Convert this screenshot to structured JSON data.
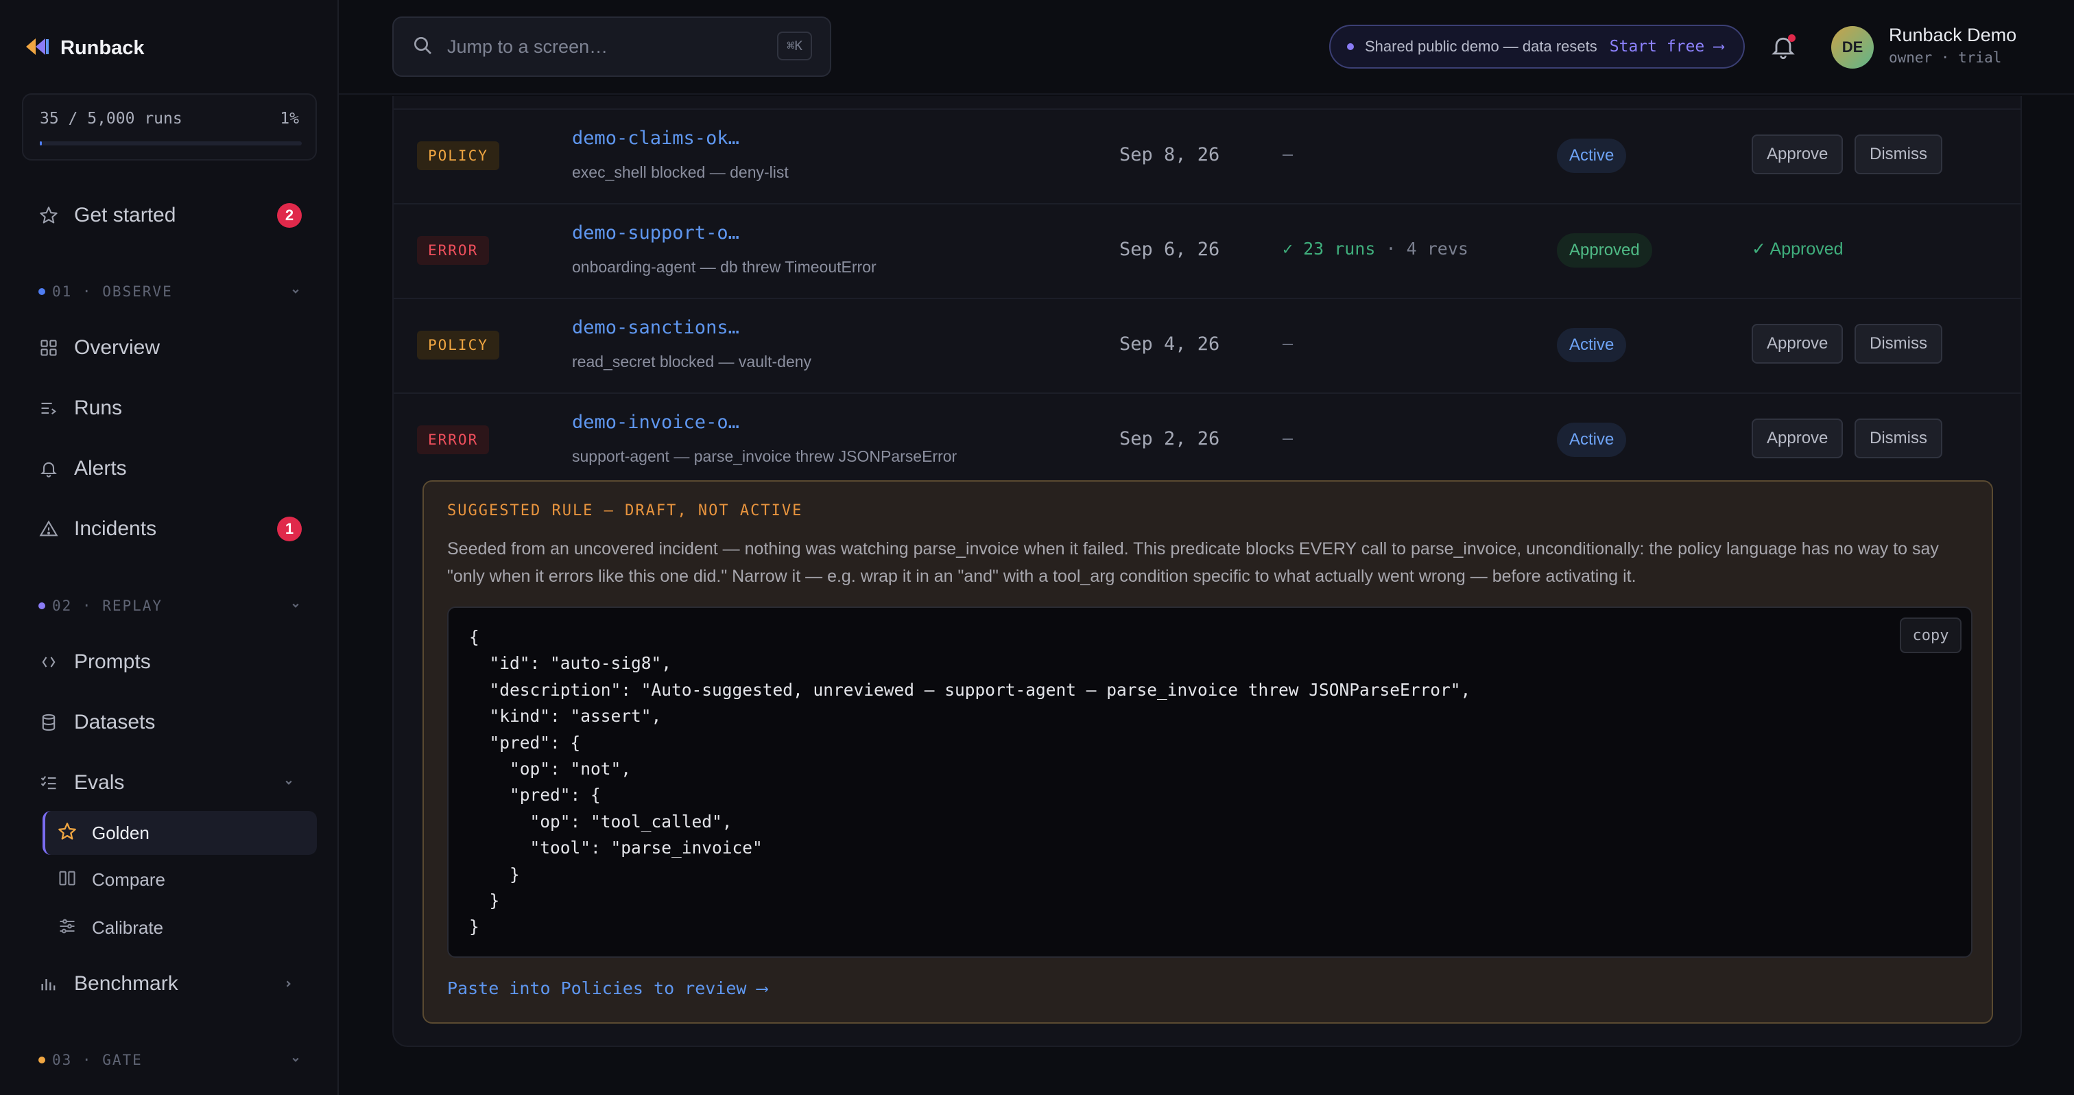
{
  "app": {
    "name": "Runback"
  },
  "usage": {
    "text": "35 / 5,000 runs",
    "percent_label": "1%",
    "fill_fraction": 0.007
  },
  "sidebar": {
    "get_started": {
      "label": "Get started",
      "badge": "2"
    },
    "sections": [
      {
        "label": "01 · OBSERVE",
        "dot_color": "#4f7df2"
      },
      {
        "label": "02 · REPLAY",
        "dot_color": "#8a7cf5"
      },
      {
        "label": "03 · GATE",
        "dot_color": "#f0a642"
      }
    ],
    "observe_items": [
      {
        "label": "Overview",
        "icon": "grid-icon"
      },
      {
        "label": "Runs",
        "icon": "list-arrow-icon"
      },
      {
        "label": "Alerts",
        "icon": "bell-icon"
      },
      {
        "label": "Incidents",
        "icon": "warning-icon",
        "badge": "1"
      }
    ],
    "replay_items": [
      {
        "label": "Prompts",
        "icon": "code-brackets-icon"
      },
      {
        "label": "Datasets",
        "icon": "database-icon"
      },
      {
        "label": "Evals",
        "icon": "checklist-icon"
      }
    ],
    "eval_subitems": [
      {
        "label": "Golden",
        "icon": "star-icon",
        "active": true
      },
      {
        "label": "Compare",
        "icon": "columns-icon"
      },
      {
        "label": "Calibrate",
        "icon": "sliders-icon"
      }
    ],
    "benchmark": {
      "label": "Benchmark",
      "icon": "bar-chart-icon"
    }
  },
  "topbar": {
    "search_placeholder": "Jump to a screen…",
    "search_shortcut": "⌘K",
    "demo_text": "Shared public demo — data resets",
    "demo_cta": "Start free ⟶",
    "user_initials": "DE",
    "user_name": "Runback Demo",
    "user_role": "owner · trial"
  },
  "rows": [
    {
      "tag": "POLICY",
      "title": "demo-claims-ok…",
      "sub": "exec_shell blocked — deny-list",
      "date": "Sep 8, 26",
      "stat": "—",
      "status": "Active"
    },
    {
      "tag": "ERROR",
      "title": "demo-support-o…",
      "sub": "onboarding-agent — db threw TimeoutError",
      "date": "Sep 6, 26",
      "stat": "✓ 23 runs",
      "stat_extra": "· 4 revs",
      "status": "Approved",
      "approved_text": "✓ Approved"
    },
    {
      "tag": "POLICY",
      "title": "demo-sanctions…",
      "sub": "read_secret blocked — vault-deny",
      "date": "Sep 4, 26",
      "stat": "—",
      "status": "Active"
    },
    {
      "tag": "ERROR",
      "title": "demo-invoice-o…",
      "sub": "support-agent — parse_invoice threw JSONParseError",
      "date": "Sep 2, 26",
      "stat": "—",
      "status": "Active"
    }
  ],
  "actions": {
    "approve": "Approve",
    "dismiss": "Dismiss"
  },
  "rule": {
    "title": "SUGGESTED RULE — DRAFT, NOT ACTIVE",
    "description": "Seeded from an uncovered incident — nothing was watching parse_invoice when it failed. This predicate blocks EVERY call to parse_invoice, unconditionally: the policy language has no way to say \"only when it errors like this one did.\" Narrow it — e.g. wrap it in an \"and\" with a tool_arg condition specific to what actually went wrong — before activating it.",
    "code": "{\n  \"id\": \"auto-sig8\",\n  \"description\": \"Auto-suggested, unreviewed — support-agent — parse_invoice threw JSONParseError\",\n  \"kind\": \"assert\",\n  \"pred\": {\n    \"op\": \"not\",\n    \"pred\": {\n      \"op\": \"tool_called\",\n      \"tool\": \"parse_invoice\"\n    }\n  }\n}",
    "copy_label": "copy",
    "link": "Paste into Policies to review ⟶"
  },
  "colors": {
    "accent": "#5f97f0",
    "brand_purple": "#8a7cf5",
    "danger": "#e0294b",
    "success": "#3fae7c",
    "warning": "#f0a642"
  }
}
